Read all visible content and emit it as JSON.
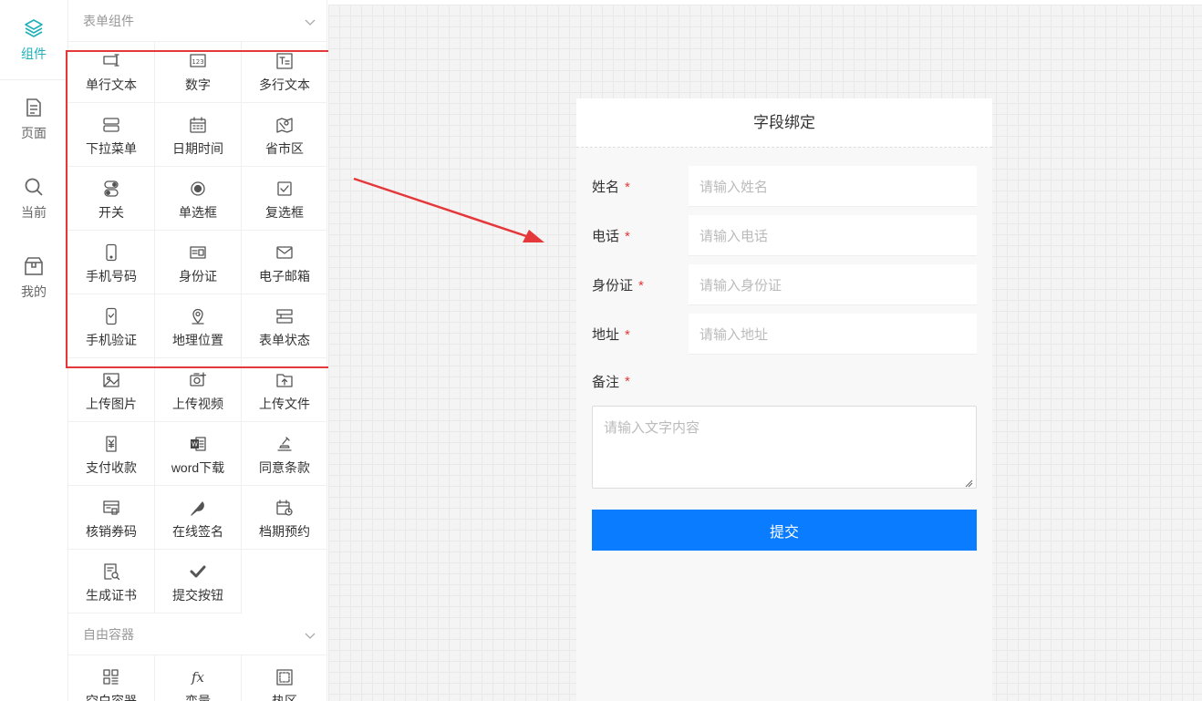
{
  "nav": [
    {
      "label": "组件",
      "icon": "layers-icon",
      "active": true
    },
    {
      "label": "页面",
      "icon": "page-icon",
      "active": false
    },
    {
      "label": "当前",
      "icon": "search-icon",
      "active": false
    },
    {
      "label": "我的",
      "icon": "box-icon",
      "active": false
    }
  ],
  "form_group": {
    "title": "表单组件",
    "items": [
      {
        "label": "单行文本",
        "icon": "single-line-text-icon"
      },
      {
        "label": "数字",
        "icon": "number-icon"
      },
      {
        "label": "多行文本",
        "icon": "multi-line-text-icon"
      },
      {
        "label": "下拉菜单",
        "icon": "dropdown-icon"
      },
      {
        "label": "日期时间",
        "icon": "calendar-icon"
      },
      {
        "label": "省市区",
        "icon": "map-region-icon"
      },
      {
        "label": "开关",
        "icon": "switch-icon"
      },
      {
        "label": "单选框",
        "icon": "radio-icon"
      },
      {
        "label": "复选框",
        "icon": "checkbox-icon"
      },
      {
        "label": "手机号码",
        "icon": "mobile-icon"
      },
      {
        "label": "身份证",
        "icon": "id-card-icon"
      },
      {
        "label": "电子邮箱",
        "icon": "mail-icon"
      },
      {
        "label": "手机验证",
        "icon": "phone-verify-icon"
      },
      {
        "label": "地理位置",
        "icon": "location-icon"
      },
      {
        "label": "表单状态",
        "icon": "form-status-icon"
      },
      {
        "label": "上传图片",
        "icon": "upload-image-icon"
      },
      {
        "label": "上传视频",
        "icon": "upload-video-icon"
      },
      {
        "label": "上传文件",
        "icon": "upload-file-icon"
      },
      {
        "label": "支付收款",
        "icon": "payment-icon"
      },
      {
        "label": "word下载",
        "icon": "word-icon"
      },
      {
        "label": "同意条款",
        "icon": "agree-terms-icon"
      },
      {
        "label": "核销券码",
        "icon": "coupon-icon"
      },
      {
        "label": "在线签名",
        "icon": "feather-icon"
      },
      {
        "label": "档期预约",
        "icon": "schedule-icon"
      },
      {
        "label": "生成证书",
        "icon": "certificate-icon"
      },
      {
        "label": "提交按钮",
        "icon": "check-icon"
      }
    ]
  },
  "free_group": {
    "title": "自由容器",
    "items": [
      {
        "label": "空白容器",
        "icon": "grid-icon"
      },
      {
        "label": "变量",
        "icon": "fx-icon"
      },
      {
        "label": "热区",
        "icon": "hotspot-icon"
      }
    ]
  },
  "phone": {
    "title": "字段绑定",
    "fields": [
      {
        "label": "姓名",
        "required": "*",
        "placeholder": "请输入姓名"
      },
      {
        "label": "电话",
        "required": "*",
        "placeholder": "请输入电话"
      },
      {
        "label": "身份证",
        "required": "*",
        "placeholder": "请输入身份证"
      },
      {
        "label": "地址",
        "required": "*",
        "placeholder": "请输入地址"
      }
    ],
    "note_label": "备注",
    "note_required": "*",
    "note_placeholder": "请输入文字内容",
    "submit_label": "提交"
  },
  "colors": {
    "accent": "#1fb0b8",
    "submit": "#0a7cff",
    "highlight": "#e5383b"
  }
}
